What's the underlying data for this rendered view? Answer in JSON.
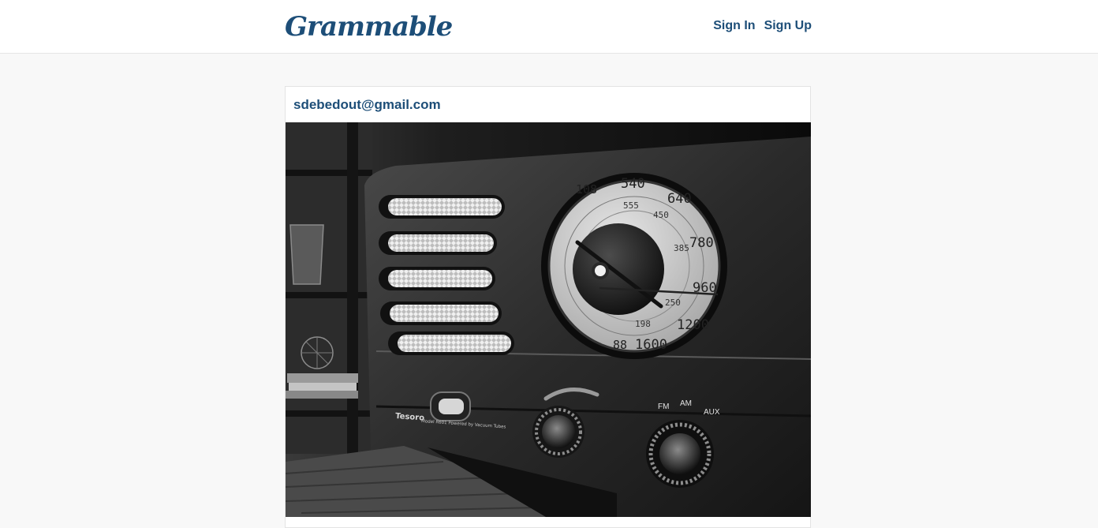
{
  "header": {
    "brand": "Grammable",
    "nav": [
      {
        "label": "Sign In"
      },
      {
        "label": "Sign Up"
      }
    ]
  },
  "post": {
    "author": "sdebedout@gmail.com",
    "photo": {
      "dial_top": [
        "108",
        "540",
        "640"
      ],
      "dial_right": [
        "780",
        "960",
        "1200"
      ],
      "dial_bottom": [
        "1600",
        "88"
      ],
      "dial_inner": [
        "555",
        "450",
        "385",
        "250",
        "198"
      ],
      "brand_text": "Tesoro",
      "model_text": "Model R601 Powered by Vacuum Tubes",
      "bands": [
        "FM",
        "AM",
        "AUX"
      ]
    }
  },
  "colors": {
    "brand": "#1d4e78",
    "page_background": "#f8f8f8",
    "card_background": "#ffffff"
  }
}
